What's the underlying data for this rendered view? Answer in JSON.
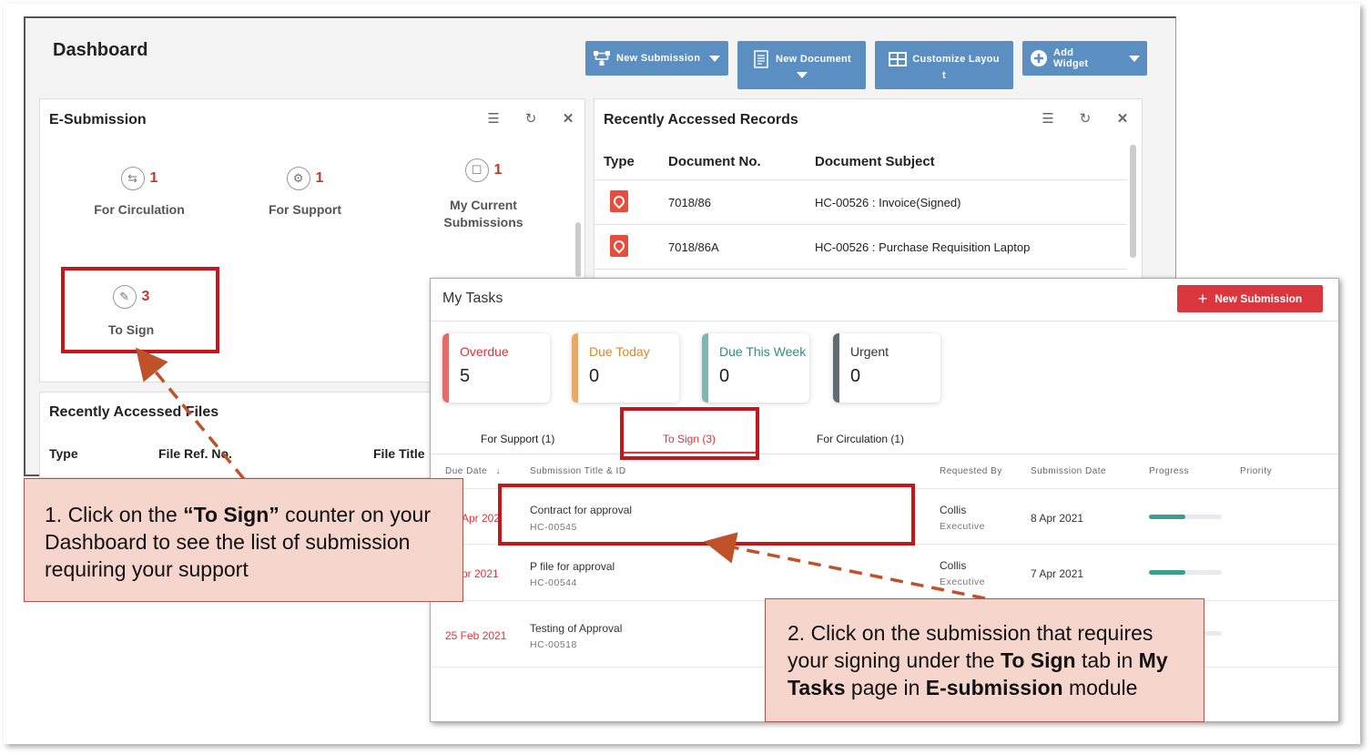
{
  "dashboard": {
    "title": "Dashboard",
    "toolbar": {
      "new_submission": "New Submission",
      "new_document": "New Document",
      "customize_layout_1": "Customize Layou",
      "customize_layout_2": "t",
      "add_widget": "Add Widget"
    }
  },
  "esubmission": {
    "title": "E-Submission",
    "counters": [
      {
        "label": "For Circulation",
        "count": "1",
        "icon": "circulation-icon"
      },
      {
        "label": "For Support",
        "count": "1",
        "icon": "support-icon"
      },
      {
        "label_1": "My Current",
        "label_2": "Submissions",
        "count": "1",
        "icon": "submissions-icon"
      },
      {
        "label": "To Sign",
        "count": "3",
        "icon": "sign-icon"
      }
    ]
  },
  "recent_records": {
    "title": "Recently Accessed Records",
    "columns": [
      "Type",
      "Document No.",
      "Document Subject"
    ],
    "rows": [
      {
        "doc_no": "7018/86",
        "subject": "HC-00526 : Invoice(Signed)"
      },
      {
        "doc_no": "7018/86A",
        "subject": "HC-00526 : Purchase Requisition Laptop"
      }
    ]
  },
  "recent_files": {
    "title": "Recently Accessed Files",
    "columns": [
      "Type",
      "File Ref. No.",
      "File Title"
    ]
  },
  "my_tasks": {
    "title": "My Tasks",
    "new_submission": "New Submission",
    "cards": [
      {
        "label": "Overdue",
        "value": "5",
        "color": "#e06c6c"
      },
      {
        "label": "Due Today",
        "value": "0",
        "color": "#e8a86a"
      },
      {
        "label": "Due This Week",
        "value": "0",
        "color": "#7fb8b0"
      },
      {
        "label": "Urgent",
        "value": "0",
        "color": "#5f6b75"
      }
    ],
    "tabs": [
      "For Support (1)",
      "To Sign (3)",
      "For Circulation (1)"
    ],
    "columns": [
      "Due Date",
      "Submission Title & ID",
      "Requested By",
      "Submission Date",
      "Progress",
      "Priority"
    ],
    "rows": [
      {
        "due": "Apr 202",
        "title": "Contract for approval",
        "id": "HC-00545",
        "requested_by": "Collis",
        "role": "Executive",
        "date": "8 Apr 2021",
        "progress": 0.5
      },
      {
        "due": "pr 2021",
        "title": "P file for approval",
        "id": "HC-00544",
        "requested_by": "Collis",
        "role": "Executive",
        "date": "7 Apr 2021",
        "progress": 0.5
      },
      {
        "due": "25 Feb 2021",
        "title": "Testing of Approval",
        "id": "HC-00518",
        "requested_by": "",
        "role": "",
        "date": "",
        "progress": 0.1
      }
    ]
  },
  "callouts": {
    "one": {
      "a": "1. Click on the ",
      "b": "“To Sign”",
      "c": " counter on your Dashboard to see the list of submission requiring your support"
    },
    "two": {
      "a": "2. Click on the submission that requires your signing under the ",
      "b": "To Sign",
      "c": " tab in ",
      "d": "My Tasks",
      "e": " page in ",
      "f": "E-submission",
      "g": " module"
    }
  },
  "colors": {
    "accent": "#5b8ec1",
    "alert": "#c4161c",
    "callout_bg": "#f6d5cc"
  }
}
